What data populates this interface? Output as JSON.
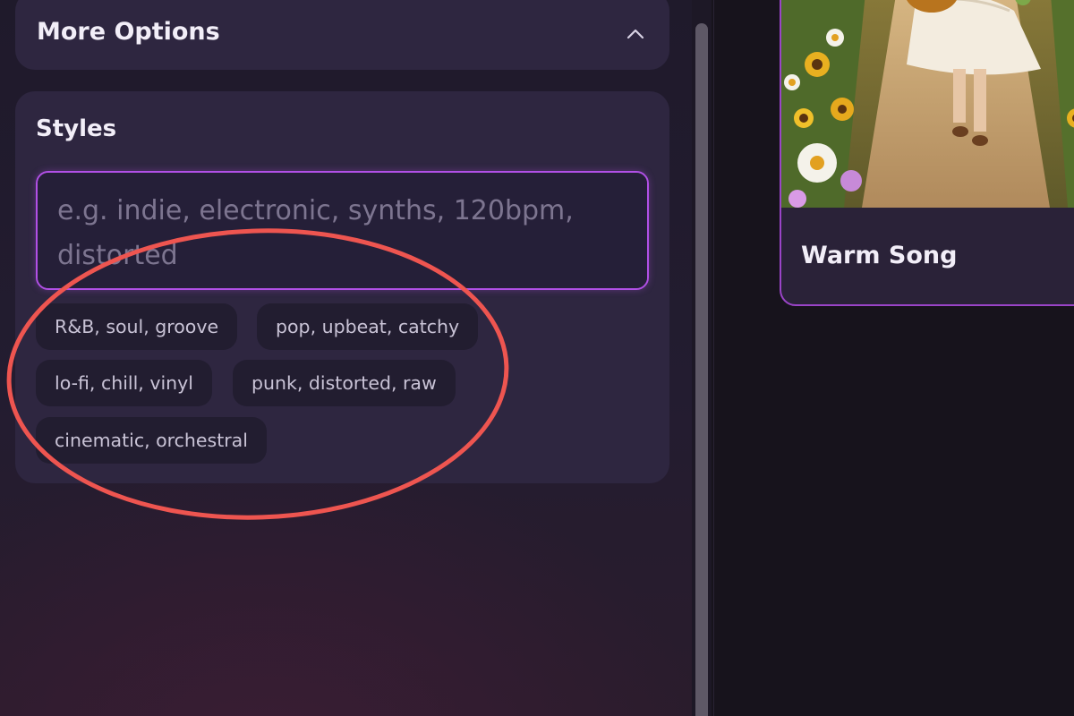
{
  "more_options": {
    "title": "More Options"
  },
  "styles": {
    "title": "Styles",
    "placeholder": "e.g. indie, electronic, synths, 120bpm, distorted",
    "chips": [
      "R&B, soul, groove",
      "pop, upbeat, catchy",
      "lo-fi, chill, vinyl",
      "punk, distorted, raw",
      "cinematic, orchestral"
    ]
  },
  "song": {
    "title": "Warm Song"
  },
  "colors": {
    "accent": "#b150e6",
    "annotation": "#ee5550",
    "card": "#2e2640",
    "chip": "#221d30"
  },
  "icons": {
    "collapse": "chevron-up-icon"
  }
}
